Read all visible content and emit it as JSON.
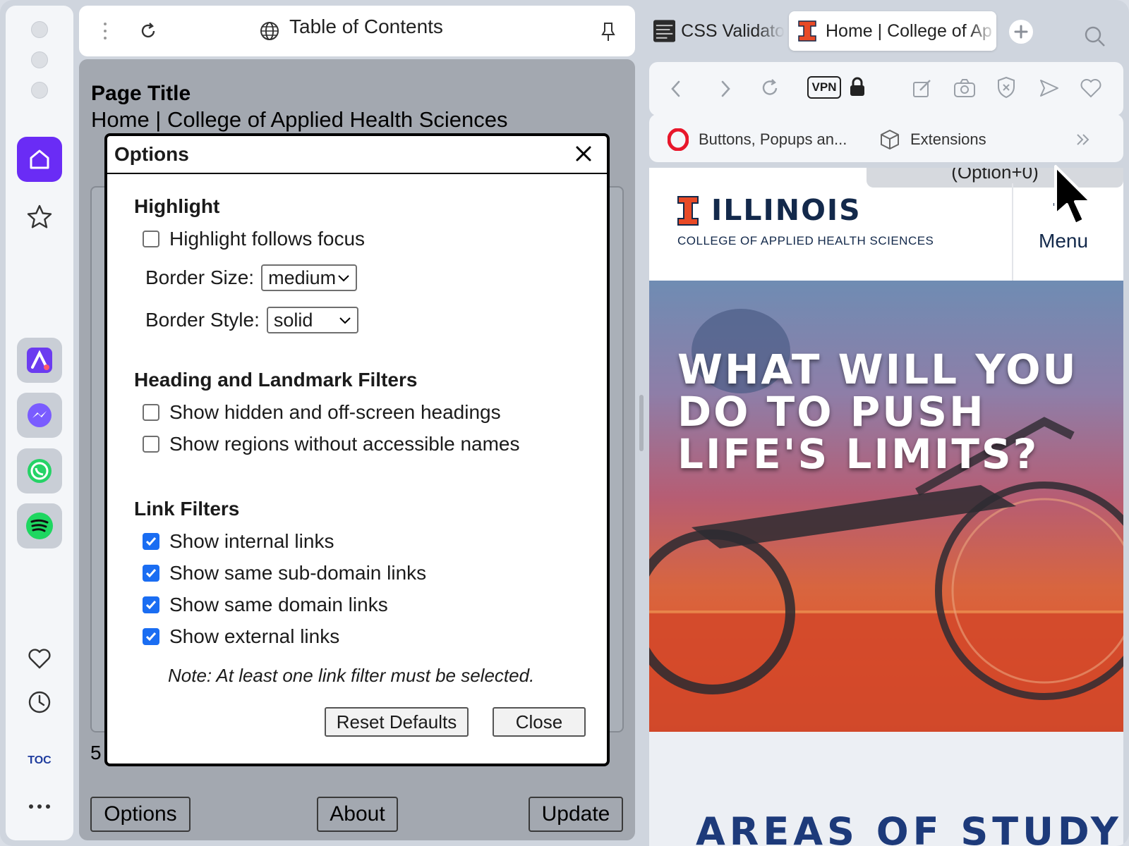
{
  "toc_header": {
    "title": "Table of Contents"
  },
  "panel": {
    "page_title_label": "Page Title",
    "page_title_value": "Home | College of Applied Health Sciences",
    "hidden_fragment": "5",
    "buttons": {
      "options": "Options",
      "about": "About",
      "update": "Update"
    }
  },
  "dialog": {
    "title": "Options",
    "sections": {
      "highlight": {
        "heading": "Highlight",
        "follows_focus": {
          "label": "Highlight follows focus",
          "checked": false
        },
        "border_size": {
          "label": "Border Size:",
          "value": "medium"
        },
        "border_style": {
          "label": "Border Style:",
          "value": "solid"
        }
      },
      "heading_filters": {
        "heading": "Heading and Landmark Filters",
        "hidden_headings": {
          "label": "Show hidden and off-screen headings",
          "checked": false
        },
        "regions": {
          "label": "Show regions without accessible names",
          "checked": false
        }
      },
      "link_filters": {
        "heading": "Link Filters",
        "internal": {
          "label": "Show internal links",
          "checked": true
        },
        "subdomain": {
          "label": "Show same sub-domain links",
          "checked": true
        },
        "domain": {
          "label": "Show same domain links",
          "checked": true
        },
        "external": {
          "label": "Show external links",
          "checked": true
        },
        "note": "Note: At least one link filter must be selected."
      }
    },
    "buttons": {
      "reset": "Reset Defaults",
      "close": "Close"
    }
  },
  "browser": {
    "tabs": [
      {
        "label": "CSS Validato",
        "active": false
      },
      {
        "label": "Home | College of Ap",
        "active": true
      }
    ],
    "toolbar": {
      "vpn": "VPN"
    },
    "bookmarks": [
      {
        "label": "Buttons, Popups an...",
        "icon": "opera-icon"
      },
      {
        "label": "Extensions",
        "icon": "cube-icon"
      }
    ]
  },
  "site": {
    "option_peek": "(Option+0)",
    "brand": "ILLINOIS",
    "college": "COLLEGE OF APPLIED HEALTH SCIENCES",
    "menu": "Menu",
    "hero_headline": "WHAT WILL YOU DO TO PUSH LIFE'S LIMITS?",
    "areas_heading": "AREAS OF STUDY"
  },
  "rail": {
    "toc_label": "TOC"
  },
  "colors": {
    "accent_purple": "#6a2cf5",
    "illinois_orange": "#e84a27",
    "illinois_blue": "#13294b",
    "checkbox_blue": "#1a6df2"
  }
}
